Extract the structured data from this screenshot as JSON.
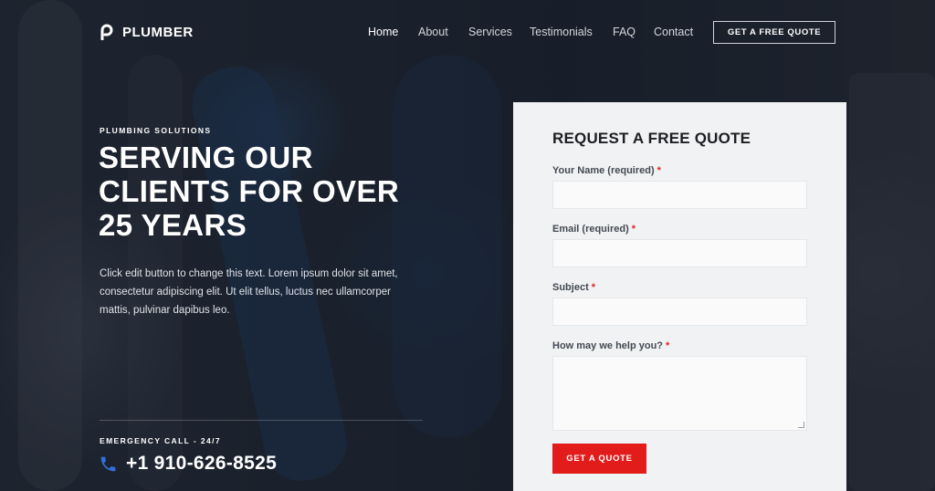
{
  "brand": {
    "name": "PLUMBER",
    "icon": "logo-p-icon"
  },
  "nav": {
    "items": [
      {
        "label": "Home",
        "active": true
      },
      {
        "label": "About",
        "active": false
      },
      {
        "label": "Services",
        "active": false
      },
      {
        "label": "Testimonials",
        "active": false
      },
      {
        "label": "FAQ",
        "active": false
      },
      {
        "label": "Contact",
        "active": false
      }
    ],
    "cta_label": "GET A FREE QUOTE"
  },
  "hero": {
    "eyebrow": "PLUMBING SOLUTIONS",
    "headline_lines": [
      "SERVING OUR",
      "CLIENTS FOR OVER",
      "25 YEARS"
    ],
    "lead": "Click edit button to change this text. Lorem ipsum dolor sit amet, consectetur adipiscing elit. Ut elit tellus, luctus nec ullamcorper mattis, pulvinar dapibus leo.",
    "emergency_label": "EMERGENCY CALL - 24/7",
    "phone": "+1 910-626-8525",
    "phone_icon": "phone-icon"
  },
  "form": {
    "title": "REQUEST A FREE QUOTE",
    "fields": [
      {
        "label": "Your Name (required)",
        "required_mark": "*",
        "value": ""
      },
      {
        "label": "Email (required)",
        "required_mark": "*",
        "value": ""
      },
      {
        "label": "Subject",
        "required_mark": "*",
        "value": ""
      },
      {
        "label": "How may we help you?",
        "required_mark": "*",
        "value": ""
      }
    ],
    "submit_label": "GET A QUOTE"
  },
  "colors": {
    "accent": "#e21b1b",
    "phone_icon": "#2f6fd6",
    "card_bg": "#f1f2f4",
    "text_light": "#ffffff"
  }
}
